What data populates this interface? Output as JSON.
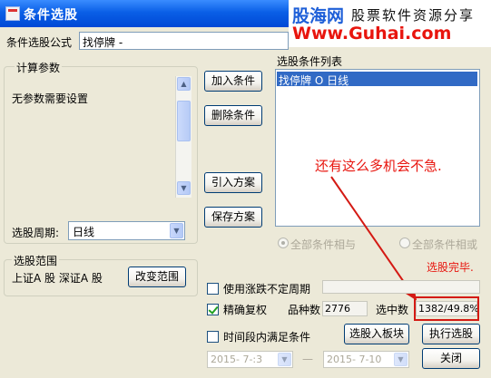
{
  "window": {
    "title": "条件选股"
  },
  "watermark": {
    "brand": "股海网",
    "tagline": "股票软件资源分享",
    "url": "Www.Guhai.com"
  },
  "formula": {
    "label": "条件选股公式",
    "value": "找停牌   -"
  },
  "params": {
    "group_title": "计算参数",
    "text": "无参数需要设置",
    "period_label": "选股周期:",
    "period_value": "日线"
  },
  "buttons": {
    "add_condition": "加入条件",
    "delete_condition": "删除条件",
    "import_plan": "引入方案",
    "save_plan": "保存方案",
    "change_range": "改变范围",
    "to_sector": "选股入板块",
    "execute": "执行选股",
    "close": "关闭"
  },
  "conditions": {
    "label": "选股条件列表",
    "items": [
      "找停牌  O  日线"
    ]
  },
  "logic": {
    "all_and": "全部条件相与",
    "all_or": "全部条件相或",
    "selected": "all_and"
  },
  "range": {
    "group_title": "选股范围",
    "text": "上证A 股 深证A 股"
  },
  "options": {
    "unadjusted_period": {
      "label": "使用涨跌不定周期",
      "checked": false
    },
    "precise_adjust": {
      "label": "精确复权",
      "checked": true
    },
    "time_range": {
      "label": "时间段内满足条件",
      "checked": false
    }
  },
  "stats": {
    "variety_label": "品种数",
    "variety_value": "2776",
    "selected_label": "选中数",
    "selected_value": "1382/49.8%"
  },
  "dates": {
    "start": "2015- 7-:3",
    "separator": "—",
    "end": "2015- 7-10"
  },
  "annotations": {
    "main_note": "还有这么多机会不急.",
    "done_note": "选股完毕."
  },
  "colors": {
    "title_bar": "#0A5FE6",
    "selection": "#316AC5",
    "annotation": "#E8150E",
    "dialog_bg": "#ECE9D8"
  }
}
